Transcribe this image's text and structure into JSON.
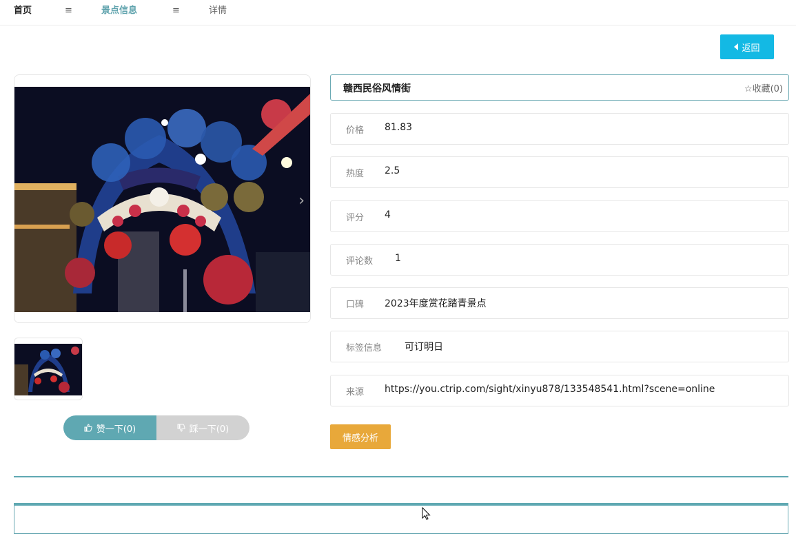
{
  "breadcrumb": {
    "home": "首页",
    "sep": "≡",
    "section": "景点信息",
    "current": "详情"
  },
  "back_label": "返回",
  "spot": {
    "name": "赣西民俗风情街",
    "favorite": "☆收藏(0)",
    "fields": [
      {
        "label": "价格",
        "value": "81.83"
      },
      {
        "label": "热度",
        "value": "2.5"
      },
      {
        "label": "评分",
        "value": "4"
      },
      {
        "label": "评论数",
        "value": "1"
      },
      {
        "label": "口碑",
        "value": "2023年度赏花踏青景点"
      },
      {
        "label": "标签信息",
        "value": "可订明日"
      },
      {
        "label": "来源",
        "value": "https://you.ctrip.com/sight/xinyu878/133548541.html?scene=online"
      }
    ]
  },
  "vote": {
    "like": "赞一下(0)",
    "dislike": "踩一下(0)"
  },
  "sentiment_label": "情感分析",
  "icons": {
    "back": "caret-left-icon",
    "next": "chevron-right-icon",
    "like": "thumb-up-icon",
    "dislike": "thumb-down-icon",
    "cursor": "mouse-cursor-icon"
  },
  "colors": {
    "accent": "#5fa8b2",
    "back_button": "#13b9e4",
    "sentiment_button": "#e8a83a"
  }
}
